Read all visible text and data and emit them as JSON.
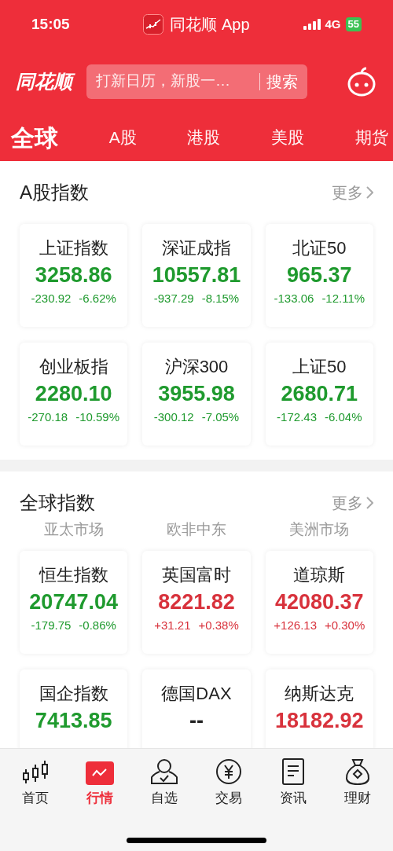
{
  "status_bar": {
    "time": "15:05",
    "app_title": "同花顺 App",
    "network": "4G",
    "battery": "55"
  },
  "header": {
    "logo": "同花顺",
    "search": {
      "placeholder": "打新日历，新股一…",
      "button": "搜索"
    }
  },
  "tabs": [
    {
      "label": "全球",
      "selected": true
    },
    {
      "label": "A股",
      "selected": false
    },
    {
      "label": "港股",
      "selected": false
    },
    {
      "label": "美股",
      "selected": false
    },
    {
      "label": "期货",
      "selected": false
    }
  ],
  "sections": [
    {
      "title": "A股指数",
      "more": "更多",
      "cards": [
        {
          "name": "上证指数",
          "value": "3258.86",
          "change": "-230.92",
          "percent": "-6.62%",
          "color": "#1f9a2e"
        },
        {
          "name": "深证成指",
          "value": "10557.81",
          "change": "-937.29",
          "percent": "-8.15%",
          "color": "#1f9a2e"
        },
        {
          "name": "北证50",
          "value": "965.37",
          "change": "-133.06",
          "percent": "-12.11%",
          "color": "#1f9a2e"
        },
        {
          "name": "创业板指",
          "value": "2280.10",
          "change": "-270.18",
          "percent": "-10.59%",
          "color": "#1f9a2e"
        },
        {
          "name": "沪深300",
          "value": "3955.98",
          "change": "-300.12",
          "percent": "-7.05%",
          "color": "#1f9a2e"
        },
        {
          "name": "上证50",
          "value": "2680.71",
          "change": "-172.43",
          "percent": "-6.04%",
          "color": "#1f9a2e"
        }
      ]
    },
    {
      "title": "全球指数",
      "more": "更多",
      "subtabs": [
        {
          "label": "亚太市场",
          "selected": false
        },
        {
          "label": "欧非中东",
          "selected": false
        },
        {
          "label": "美洲市场",
          "selected": false
        }
      ],
      "cards": [
        {
          "name": "恒生指数",
          "value": "20747.04",
          "change": "-179.75",
          "percent": "-0.86%",
          "color": "#1f9a2e"
        },
        {
          "name": "英国富时",
          "value": "8221.82",
          "change": "+31.21",
          "percent": "+0.38%",
          "color": "#d8323c"
        },
        {
          "name": "道琼斯",
          "value": "42080.37",
          "change": "+126.13",
          "percent": "+0.30%",
          "color": "#d8323c"
        },
        {
          "name": "国企指数",
          "value": "7413.85",
          "color": "#1f9a2e"
        },
        {
          "name": "德国DAX",
          "value": "--",
          "color": "#222222"
        },
        {
          "name": "纳斯达克",
          "value": "18182.92",
          "color": "#d8323c"
        }
      ]
    }
  ],
  "bottom_nav": [
    {
      "label": "首页",
      "selected": false
    },
    {
      "label": "行情",
      "selected": true
    },
    {
      "label": "自选",
      "selected": false
    },
    {
      "label": "交易",
      "selected": false
    },
    {
      "label": "资讯",
      "selected": false
    },
    {
      "label": "理财",
      "selected": false
    }
  ]
}
